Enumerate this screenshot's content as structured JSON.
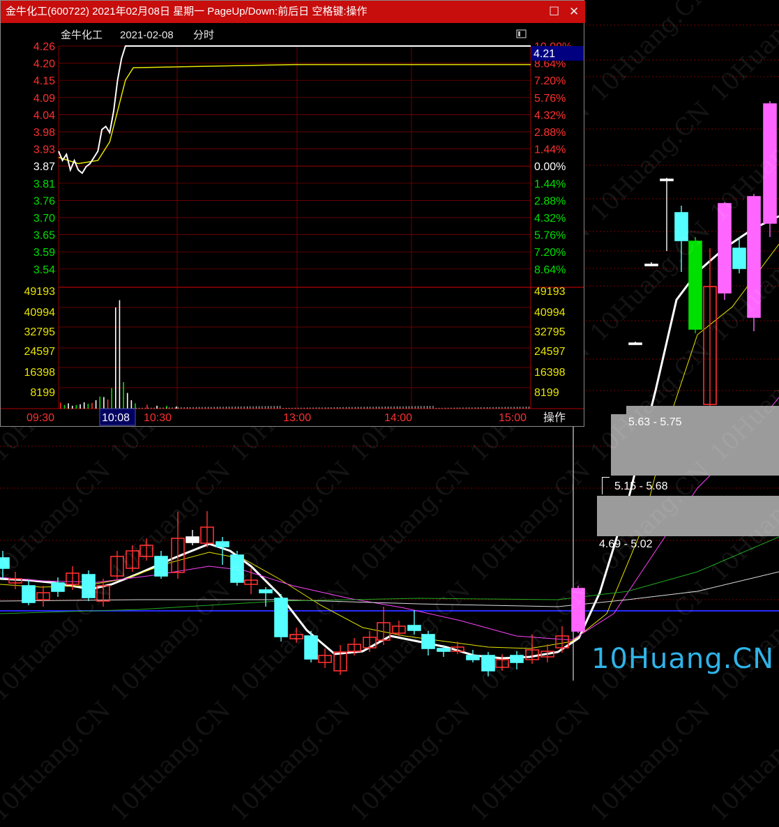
{
  "window": {
    "title": "金牛化工(600722) 2021年02月08日 星期一 PageUp/Down:前后日 空格键:操作",
    "maximize_icon": "maximize-icon",
    "close_icon": "close-icon"
  },
  "chart_header": {
    "stock_name": "金牛化工",
    "date": "2021-02-08",
    "mode": "分时"
  },
  "colors": {
    "title_bar": "#c80d0d",
    "price_up": "#ff3030",
    "price_down": "#00e000",
    "neutral": "#ffffff",
    "volume_axis": "#e8e600",
    "avg_line": "#e8e600",
    "grid": "#8b0000",
    "highlight_box": "#000080",
    "candle_up_pink": "#ff66ff",
    "candle_cyan": "#55ffff",
    "brand": "#2fb4e8"
  },
  "price_axis_left": [
    "4.26",
    "4.20",
    "4.15",
    "4.09",
    "4.04",
    "3.98",
    "3.93",
    "3.87",
    "3.81",
    "3.76",
    "3.70",
    "3.65",
    "3.59",
    "3.54"
  ],
  "pct_axis_right": [
    "10.09%",
    "8.64%",
    "7.20%",
    "5.76%",
    "4.32%",
    "2.88%",
    "1.44%",
    "0.00%",
    "1.44%",
    "2.88%",
    "4.32%",
    "5.76%",
    "7.20%",
    "8.64%"
  ],
  "current_price_box": "4.21",
  "volume_axis": [
    "49193",
    "40994",
    "32795",
    "24597",
    "16398",
    "8199"
  ],
  "time_axis": [
    "09:30",
    "10:08",
    "10:30",
    "13:00",
    "14:00",
    "15:00"
  ],
  "footer_button": "操作",
  "chart_data": {
    "type": "line",
    "title": "金牛化工 2021-02-08 分时",
    "prev_close": 3.87,
    "ylim": [
      3.48,
      4.26
    ],
    "x_range": [
      "09:30",
      "15:00"
    ],
    "price_series": {
      "name": "price",
      "x": [
        "09:30",
        "09:32",
        "09:34",
        "09:36",
        "09:38",
        "09:40",
        "09:42",
        "09:44",
        "09:46",
        "09:48",
        "09:50",
        "09:52",
        "09:54",
        "09:56",
        "09:58",
        "10:00",
        "10:02",
        "10:04",
        "10:06",
        "10:08",
        "15:00"
      ],
      "values": [
        3.92,
        3.89,
        3.91,
        3.86,
        3.89,
        3.86,
        3.85,
        3.87,
        3.88,
        3.9,
        3.92,
        3.99,
        4.0,
        3.98,
        4.05,
        4.15,
        4.22,
        4.26,
        4.26,
        4.26,
        4.26
      ]
    },
    "avg_series": {
      "name": "avg",
      "x": [
        "09:30",
        "09:40",
        "09:50",
        "09:56",
        "10:00",
        "10:04",
        "10:08",
        "11:30",
        "15:00"
      ],
      "values": [
        3.9,
        3.88,
        3.89,
        3.95,
        4.05,
        4.15,
        4.19,
        4.2,
        4.2
      ]
    },
    "volume": {
      "x": [
        "09:31",
        "09:33",
        "09:35",
        "09:37",
        "09:39",
        "09:41",
        "09:43",
        "09:45",
        "09:47",
        "09:49",
        "09:51",
        "09:53",
        "09:55",
        "09:57",
        "09:59",
        "10:01",
        "10:03",
        "10:05",
        "10:07",
        "10:09",
        "10:15",
        "10:20",
        "10:25",
        "10:30"
      ],
      "values": [
        2500,
        1500,
        2200,
        1200,
        1500,
        1800,
        2600,
        2000,
        2400,
        3500,
        5000,
        4800,
        3800,
        8500,
        42000,
        45000,
        11000,
        6500,
        3500,
        2200,
        1600,
        1200,
        1100,
        900
      ]
    }
  },
  "bg_zones": [
    {
      "label": "5.63 - 5.75"
    },
    {
      "label": "5.15 - 5.68"
    },
    {
      "label": "4.69 - 5.02"
    }
  ],
  "watermark": "10Huang.CN",
  "brand": "10Huang.CN"
}
